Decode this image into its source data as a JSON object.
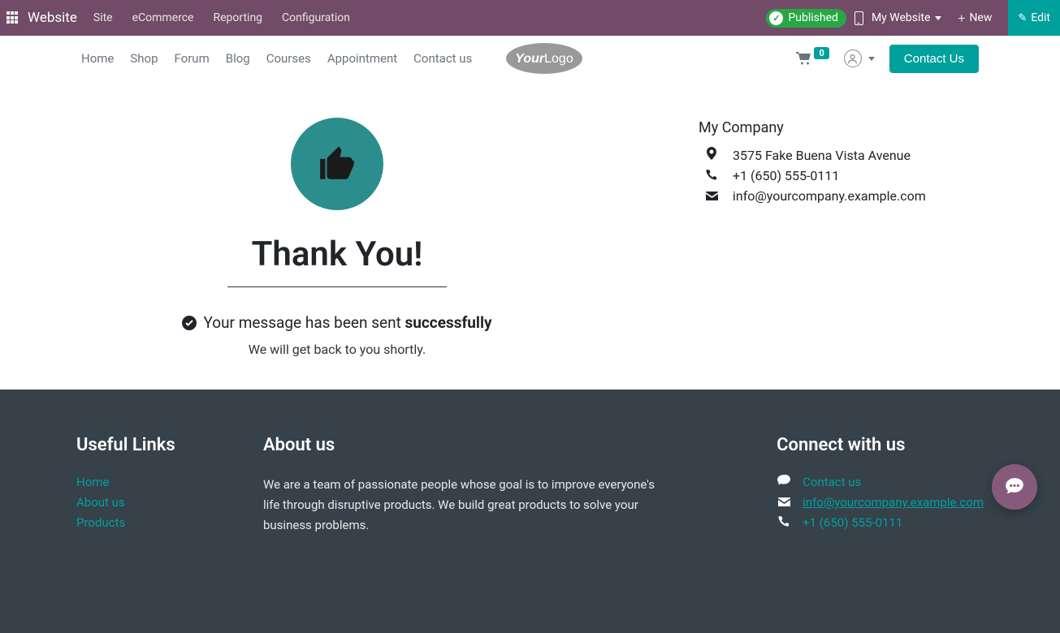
{
  "topbar": {
    "app": "Website",
    "menu": [
      "Site",
      "eCommerce",
      "Reporting",
      "Configuration"
    ],
    "published": "Published",
    "site_selector": "My Website",
    "new": "New",
    "edit": "Edit"
  },
  "navbar": {
    "links": [
      "Home",
      "Shop",
      "Forum",
      "Blog",
      "Courses",
      "Appointment",
      "Contact us"
    ],
    "cart_count": "0",
    "contact_btn": "Contact Us"
  },
  "main": {
    "heading": "Thank You!",
    "success_prefix": "Your message has been sent ",
    "success_bold": "successfully",
    "followup": "We will get back to you shortly."
  },
  "company": {
    "name": "My Company",
    "address": "3575 Fake Buena Vista Avenue",
    "phone": "+1 (650) 555-0111",
    "email": "info@yourcompany.example.com"
  },
  "footer": {
    "useful_title": "Useful Links",
    "useful_links": [
      "Home",
      "About us",
      "Products"
    ],
    "about_title": "About us",
    "about_text": "We are a team of passionate people whose goal is to improve everyone's life through disruptive products. We build great products to solve your business problems.",
    "connect_title": "Connect with us",
    "connect_contact": "Contact us",
    "connect_email": "info@yourcompany.example.com",
    "connect_phone": "+1 (650) 555-0111"
  }
}
